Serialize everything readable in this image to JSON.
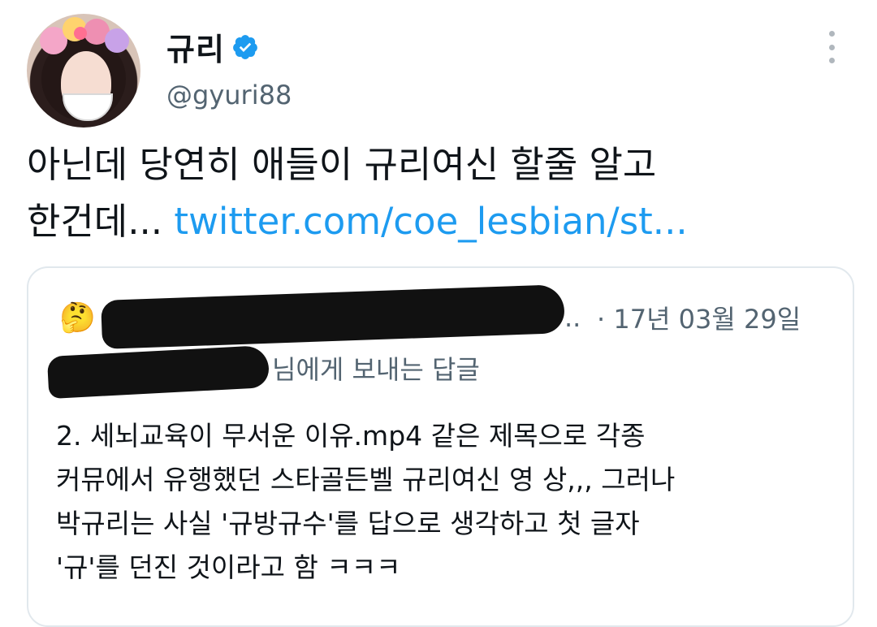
{
  "user": {
    "display_name": "규리",
    "handle": "@gyuri88"
  },
  "tweet": {
    "line1": "아닌데 당연히 애들이 규리여신 할줄 알고",
    "line2_text": "한건데... ",
    "link": "twitter.com/coe_lesbian/st..."
  },
  "quote": {
    "avatar_emoji": "🤔",
    "name_ellipsis": "..",
    "date": "· 17년 03월 29일",
    "reply_suffix": "님에게 보내는 답글",
    "body_lines": [
      "2. 세뇌교육이 무서운 이유.mp4 같은 제목으로 각종",
      "커뮤에서 유행했던 스타골든벨 규리여신 영 상,,, 그러나",
      "박규리는 사실 '규방규수'를 답으로 생각하고 첫 글자",
      "'규'를 던진 것이라고 함 ㅋㅋㅋ"
    ]
  },
  "colors": {
    "link": "#1d9bf0",
    "secondary_text": "#536471",
    "verified": "#1d9bf0"
  },
  "icons": {
    "verified": "verified-badge-icon",
    "more": "more-options-icon"
  }
}
